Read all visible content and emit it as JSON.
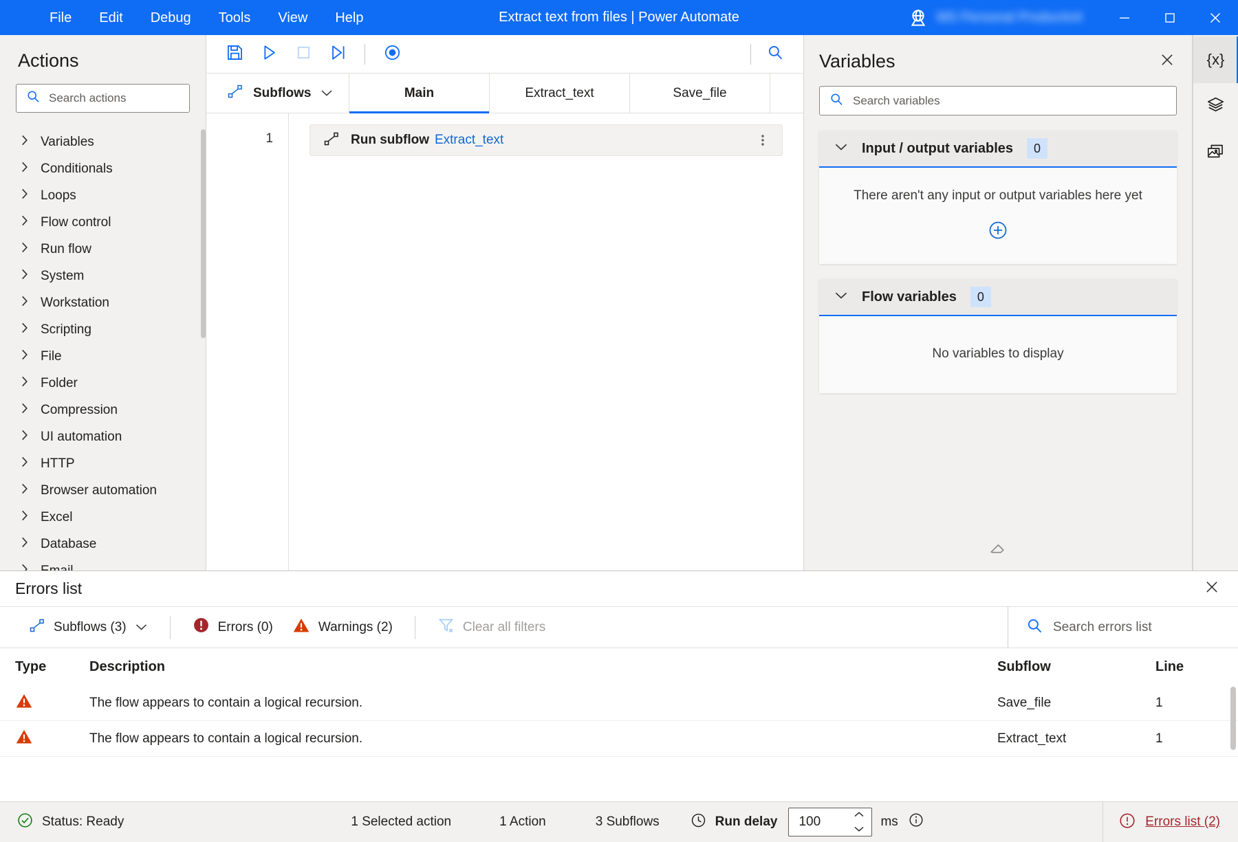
{
  "titlebar": {
    "menus": [
      "File",
      "Edit",
      "Debug",
      "Tools",
      "View",
      "Help"
    ],
    "title": "Extract text from files | Power Automate",
    "account_name": "MS Personal Productivit",
    "globe_icon": "globe-icon",
    "minimize_icon": "minimize-icon",
    "maximize_icon": "maximize-icon",
    "close_icon": "close-icon",
    "accent_color": "#0f6cf5"
  },
  "actions_pane": {
    "title": "Actions",
    "search_placeholder": "Search actions",
    "search_value": "",
    "search_icon": "search-icon",
    "groups": [
      {
        "label": "Variables"
      },
      {
        "label": "Conditionals"
      },
      {
        "label": "Loops"
      },
      {
        "label": "Flow control"
      },
      {
        "label": "Run flow"
      },
      {
        "label": "System"
      },
      {
        "label": "Workstation"
      },
      {
        "label": "Scripting"
      },
      {
        "label": "File"
      },
      {
        "label": "Folder"
      },
      {
        "label": "Compression"
      },
      {
        "label": "UI automation"
      },
      {
        "label": "HTTP"
      },
      {
        "label": "Browser automation"
      },
      {
        "label": "Excel"
      },
      {
        "label": "Database"
      },
      {
        "label": "Email"
      }
    ]
  },
  "toolbar": {
    "save_icon": "save-icon",
    "run_icon": "run-icon",
    "stop_icon": "stop-icon",
    "run_next_action_icon": "run-next-action-icon",
    "record_icon": "record-icon",
    "search_icon": "search-icon"
  },
  "tabs": {
    "subflows_label": "Subflows",
    "subflows_icon": "subflow-icon",
    "subflows_chevron_icon": "chevron-down-icon",
    "items": [
      {
        "label": "Main",
        "active": true
      },
      {
        "label": "Extract_text",
        "active": false
      },
      {
        "label": "Save_file",
        "active": false
      }
    ]
  },
  "canvas": {
    "rows": [
      {
        "line": "1",
        "icon": "subflow-icon",
        "label": "Run subflow",
        "argument": "Extract_text",
        "more_icon": "more-options-icon"
      }
    ]
  },
  "variables_pane": {
    "title": "Variables",
    "close_icon": "close-icon",
    "search_placeholder": "Search variables",
    "search_value": "",
    "search_icon": "search-icon",
    "cards": [
      {
        "title": "Input / output variables",
        "count": "0",
        "chevron_icon": "chevron-down-icon",
        "empty_text": "There aren't any input or output variables here yet",
        "add_icon": "add-circle-icon",
        "has_add": true
      },
      {
        "title": "Flow variables",
        "count": "0",
        "chevron_icon": "chevron-down-icon",
        "empty_text": "No variables to display",
        "has_add": false
      }
    ],
    "eraser_icon": "eraser-icon"
  },
  "rail": {
    "items": [
      {
        "name": "variables-rail-button",
        "glyph": "{x}",
        "icon": "variables-icon",
        "active": true
      },
      {
        "name": "ui-elements-rail-button",
        "glyph": "",
        "icon": "layers-icon",
        "active": false
      },
      {
        "name": "images-rail-button",
        "glyph": "",
        "icon": "images-icon",
        "active": false
      }
    ]
  },
  "errors_panel": {
    "title": "Errors list",
    "close_icon": "close-icon",
    "filters": {
      "subflows_label": "Subflows (3)",
      "subflows_icon": "subflow-icon",
      "subflows_chevron_icon": "chevron-down-icon",
      "errors_label": "Errors (0)",
      "errors_icon": "error-icon",
      "warnings_label": "Warnings (2)",
      "warnings_icon": "warning-icon",
      "clear_filters_label": "Clear all filters",
      "clear_filters_icon": "clear-filter-icon",
      "search_placeholder": "Search errors list",
      "search_value": "",
      "search_icon": "search-icon"
    },
    "columns": [
      "Type",
      "Description",
      "Subflow",
      "Line"
    ],
    "rows": [
      {
        "type_icon": "warning-icon",
        "description": "The flow appears to contain a logical recursion.",
        "subflow": "Save_file",
        "line": "1"
      },
      {
        "type_icon": "warning-icon",
        "description": "The flow appears to contain a logical recursion.",
        "subflow": "Extract_text",
        "line": "1"
      }
    ]
  },
  "statusbar": {
    "status_icon": "status-ok-icon",
    "status_text": "Status: Ready",
    "selected_action_text": "1 Selected action",
    "action_count_text": "1 Action",
    "subflow_count_text": "3 Subflows",
    "run_delay_icon": "clock-icon",
    "run_delay_label": "Run delay",
    "run_delay_value": "100",
    "run_delay_unit": "ms",
    "info_icon": "info-icon",
    "errors_link_icon": "error-icon",
    "errors_link_text": "Errors list (2)"
  },
  "colors": {
    "accent": "#0f6cf5",
    "warning": "#d83b01",
    "error": "#a4262c",
    "success": "#107c10",
    "link": "#1267d4"
  }
}
